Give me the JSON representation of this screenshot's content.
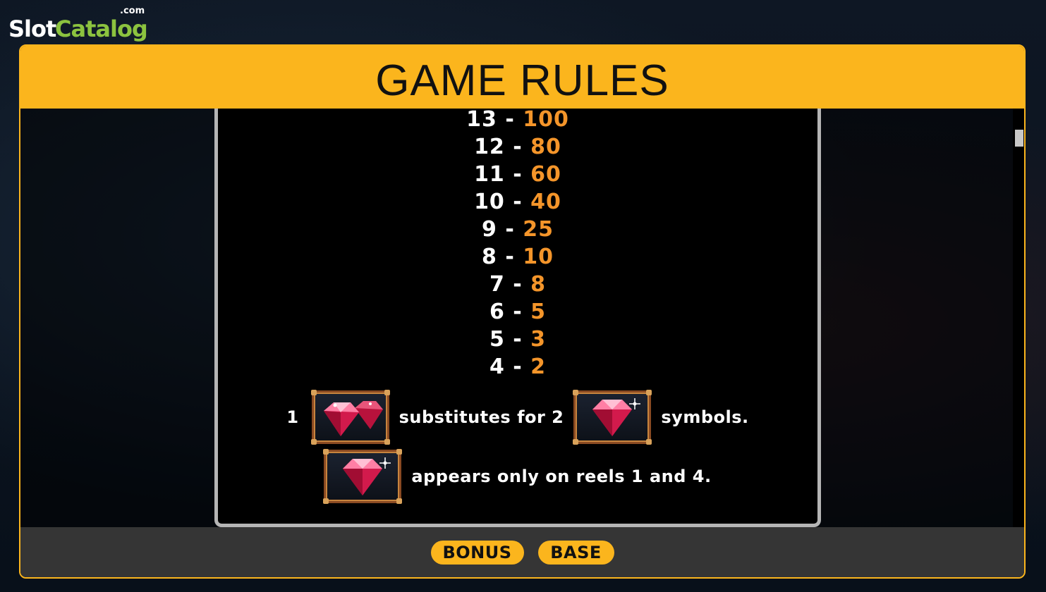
{
  "logo": {
    "slot": "Slot",
    "catalog": "Catalog",
    "dotcom": ".com"
  },
  "header": {
    "title": "GAME RULES"
  },
  "paytable": [
    {
      "count": "13",
      "sep": "-",
      "value": "100"
    },
    {
      "count": "12",
      "sep": "-",
      "value": "80"
    },
    {
      "count": "11",
      "sep": "-",
      "value": "60"
    },
    {
      "count": "10",
      "sep": "-",
      "value": "40"
    },
    {
      "count": "9",
      "sep": "-",
      "value": "25"
    },
    {
      "count": "8",
      "sep": "-",
      "value": "10"
    },
    {
      "count": "7",
      "sep": "-",
      "value": "8"
    },
    {
      "count": "6",
      "sep": "-",
      "value": "5"
    },
    {
      "count": "5",
      "sep": "-",
      "value": "3"
    },
    {
      "count": "4",
      "sep": "-",
      "value": "2"
    }
  ],
  "rules": {
    "substitute_count": "1",
    "substitute_text": "substitutes for 2",
    "substitute_suffix": "symbols.",
    "reels_text": "appears only on reels 1 and 4."
  },
  "symbols": {
    "double_gem": "double-ruby-symbol-icon",
    "single_gem": "ruby-symbol-icon"
  },
  "footer": {
    "bonus_label": "BONUS",
    "base_label": "BASE"
  },
  "colors": {
    "accent": "#fbb51d",
    "value": "#f4952a",
    "logo_green": "#8cc33f"
  }
}
